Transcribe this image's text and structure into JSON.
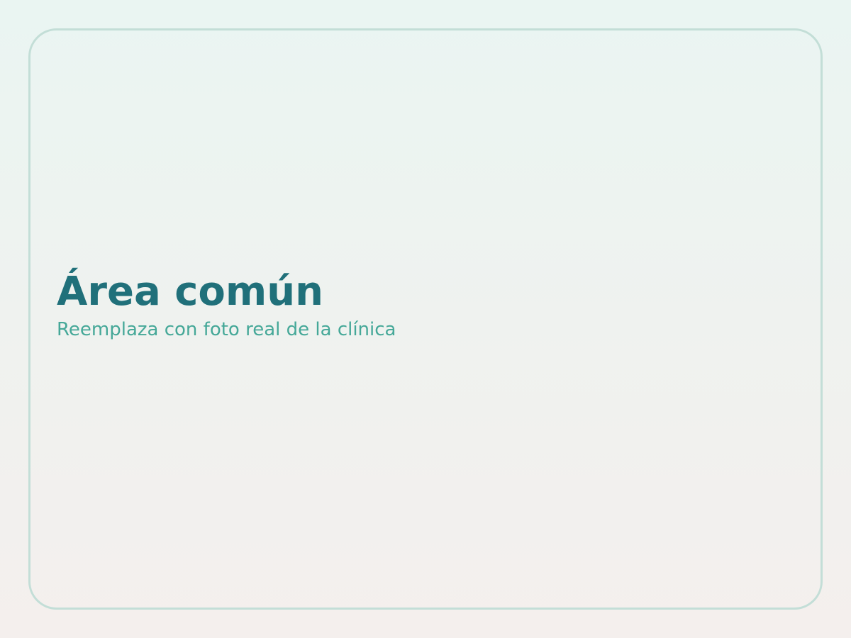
{
  "placeholder": {
    "title": "Área común",
    "subtitle": "Reemplaza con foto real de la clínica"
  },
  "colors": {
    "title": "#20707a",
    "subtitle": "#45a898",
    "border": "#c3ded7",
    "background_top": "#eaf5f2",
    "background_bottom": "#f4efed"
  }
}
